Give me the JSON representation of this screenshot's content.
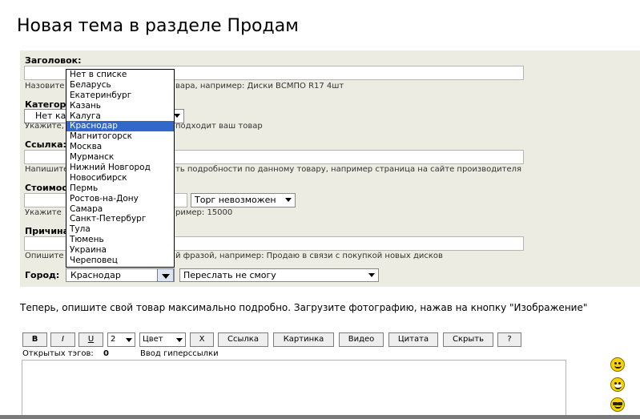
{
  "page": {
    "title": "Новая тема в разделе Продам"
  },
  "form": {
    "heading": {
      "label": "Заголовок:",
      "value": "",
      "hint_left": "Назовите",
      "hint_right": "вара, например: Диски ВСМПО R17 4шт"
    },
    "category": {
      "label": "Категор",
      "selected": "Нет ка",
      "hint_left": "Укажите,",
      "hint_right": "подходит ваш товар"
    },
    "link": {
      "label": "Ссылка:",
      "value": "",
      "hint_left": "Напишите",
      "hint_right": "ть подробности по данному товару, например страница на сайте производителя"
    },
    "price": {
      "label": "Стоимос",
      "value": "",
      "bargain_selected": "Торг невозможен",
      "hint_left": "Укажите",
      "hint_right": "ример: 15000"
    },
    "reason": {
      "label": "Причина",
      "value": "",
      "hint_left": "Опишите",
      "hint_right": "й фразой, например: Продаю в связи с покупкой новых дисков"
    },
    "city": {
      "label": "Город:",
      "selected": "Краснодар",
      "forward_selected": "Переслать не смогу",
      "options": [
        "Нет в списке",
        "Беларусь",
        "Екатеринбург",
        "Казань",
        "Калуга",
        "Краснодар",
        "Магнитогорск",
        "Москва",
        "Мурманск",
        "Нижний Новгород",
        "Новосибирск",
        "Пермь",
        "Ростов-на-Дону",
        "Самара",
        "Санкт-Петербург",
        "Тула",
        "Тюмень",
        "Украина",
        "Череповец"
      ],
      "highlighted_index": 5
    }
  },
  "intro_text": "Теперь, опишите свой товар максимально подробно. Загрузите фотографию, нажав на кнопку \"Изображение\"",
  "toolbar": {
    "bold": "B",
    "italic": "I",
    "underline": "U",
    "size": "2",
    "color": "Цвет",
    "clear": "X",
    "link": "Ссылка",
    "image": "Картинка",
    "video": "Видео",
    "quote": "Цитата",
    "hide": "Скрыть",
    "help": "?"
  },
  "status": {
    "open_tags_label": "Открытых тэгов:",
    "open_tags_count": "0",
    "mode": "Ввод гиперссылки"
  },
  "editor": {
    "value": ""
  },
  "smileys": [
    "smile-icon",
    "grin-icon",
    "cool-icon"
  ]
}
